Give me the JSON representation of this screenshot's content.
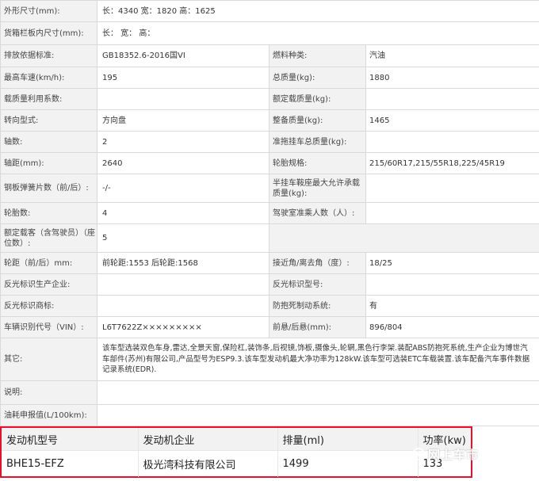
{
  "rows": [
    {
      "l1": "外形尺寸(mm):",
      "v1": "长：4340 宽：1820 高：1625"
    },
    {
      "l1": "货箱栏板内尺寸(mm):",
      "v1": "长：  宽：  高："
    },
    {
      "l1": "排放依据标准:",
      "v1": "GB18352.6-2016国VI",
      "l2": "燃料种类:",
      "v2": "汽油"
    },
    {
      "l1": "最高车速(km/h):",
      "v1": "195",
      "l2": "总质量(kg):",
      "v2": "1880"
    },
    {
      "l1": "载质量利用系数:",
      "v1": "",
      "l2": "额定载质量(kg):",
      "v2": ""
    },
    {
      "l1": "转向型式:",
      "v1": "方向盘",
      "l2": "整备质量(kg):",
      "v2": "1465"
    },
    {
      "l1": "轴数:",
      "v1": "2",
      "l2": "准拖挂车总质量(kg):",
      "v2": ""
    },
    {
      "l1": "轴距(mm):",
      "v1": "2640",
      "l2": "轮胎规格:",
      "v2": "215/60R17,215/55R18,225/45R19"
    },
    {
      "l1": "钢板弹簧片数（前/后）:",
      "v1": "-/-",
      "l2": "半挂车鞍座最大允许承载质量(kg):",
      "v2": ""
    },
    {
      "l1": "轮胎数:",
      "v1": "4",
      "l2": "驾驶室准乘人数（人）:",
      "v2": ""
    },
    {
      "l1": "额定载客（含驾驶员）（座位数）:",
      "v1": "5"
    },
    {
      "l1": "轮距（前/后）mm:",
      "v1": "前轮距:1553 后轮距:1568",
      "l2": "接近角/离去角（度）:",
      "v2": "18/25"
    },
    {
      "l1": "反光标识生产企业:",
      "v1": "",
      "l2": "反光标识型号:",
      "v2": ""
    },
    {
      "l1": "反光标识商标:",
      "v1": "",
      "l2": "防抱死制动系统:",
      "v2": "有"
    },
    {
      "l1": "车辆识别代号（VIN）:",
      "v1": "L6T7622Z×××××××××",
      "l2": "前悬/后悬(mm):",
      "v2": "896/804"
    },
    {
      "l1": "其它:",
      "v1": "该车型选装双色车身,雷达,全景天窗,保险杠,装饰条,后视镜,饰板,摄像头,轮辋,黑色行李架.装配ABS防抱死系统,生产企业为博世汽车部件(苏州)有限公司,产品型号为ESP9.3.该车型发动机最大净功率为128kW.该车型可选装ETC车载装置.该车配备汽车事件数据记录系统(EDR)."
    },
    {
      "l1": "说明:",
      "v1": ""
    },
    {
      "l1": "油耗申报值(L/100km):",
      "v1": ""
    }
  ],
  "engine": {
    "headers": [
      "发动机型号",
      "发动机企业",
      "排量(ml)",
      "功率(kw)"
    ],
    "values": [
      "BHE15-EFZ",
      "极光湾科技有限公司",
      "1499",
      "133"
    ]
  },
  "watermark": "网上车市",
  "colors": {
    "highlight_border": "#e8102a",
    "label_bg": "#f2f2f2",
    "grid": "#d9d9d9"
  }
}
